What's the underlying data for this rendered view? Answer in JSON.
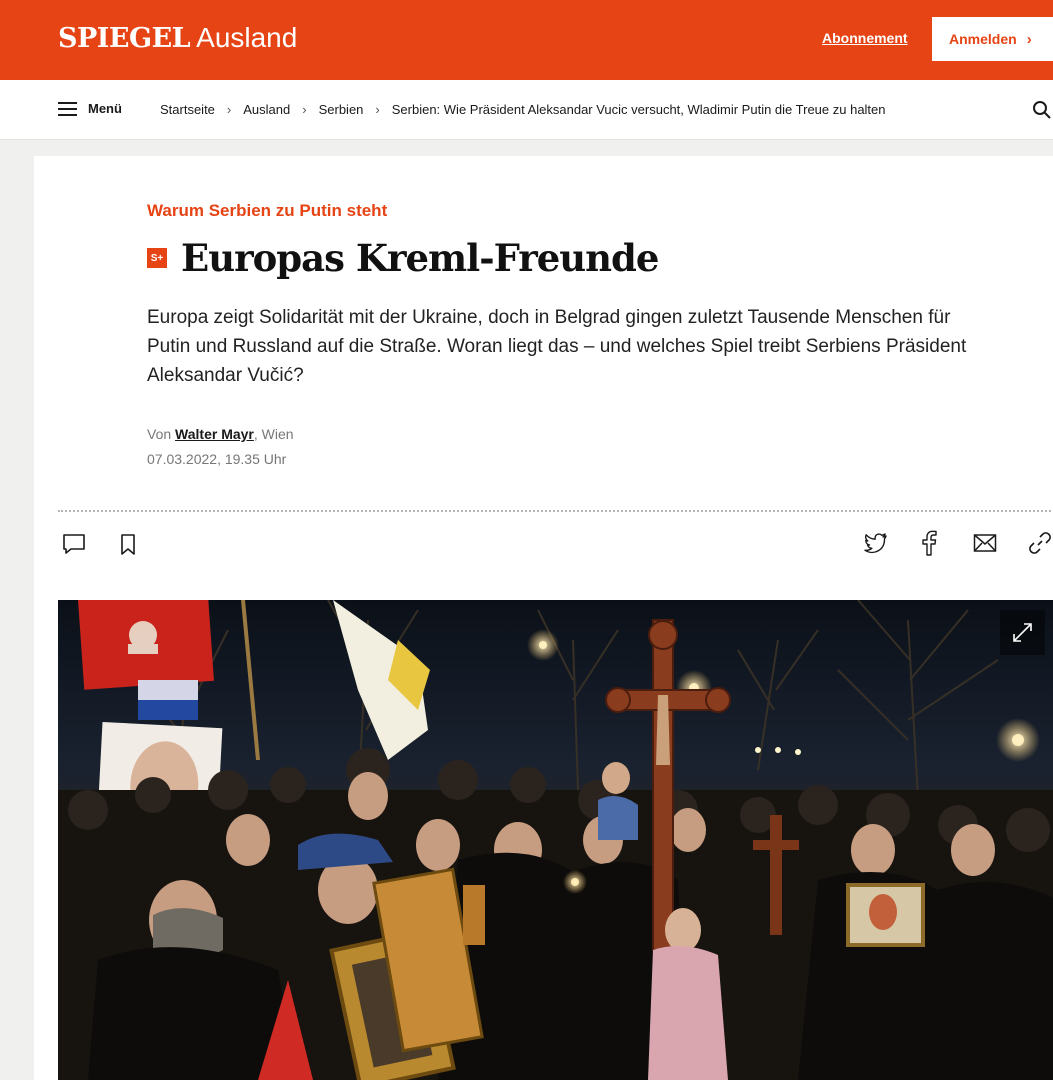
{
  "header": {
    "logo": "SPIEGEL",
    "section": "Ausland",
    "subscription_label": "Abonnement",
    "login_label": "Anmelden",
    "login_chevron": "›"
  },
  "nav": {
    "menu_label": "Menü",
    "breadcrumbs": [
      "Startseite",
      "Ausland",
      "Serbien",
      "Serbien: Wie Präsident Aleksandar Vucic versucht, Wladimir Putin die Treue zu halten"
    ],
    "separator": "›"
  },
  "article": {
    "kicker": "Warum Serbien zu Putin steht",
    "badge": "S+",
    "title": "Europas Kreml-Freunde",
    "lead": "Europa zeigt Solidarität mit der Ukraine, doch in Belgrad gingen zuletzt Tausende Menschen für Putin und Russland auf die Straße. Woran liegt das – und welches Spiel treibt Serbiens Präsident Aleksandar Vučić?",
    "author_prefix": "Von ",
    "author": "Walter Mayr",
    "location": ", Wien",
    "date": "07.03.2022, 19.35 Uhr"
  },
  "colors": {
    "brand": "#e64415",
    "text": "#1a1a1a",
    "meta": "#777777"
  },
  "icons": {
    "left": [
      "comment-icon",
      "bookmark-icon"
    ],
    "right": [
      "twitter-icon",
      "facebook-icon",
      "mail-icon",
      "link-icon"
    ],
    "top_right": "search-icon",
    "photo": "expand-icon"
  }
}
